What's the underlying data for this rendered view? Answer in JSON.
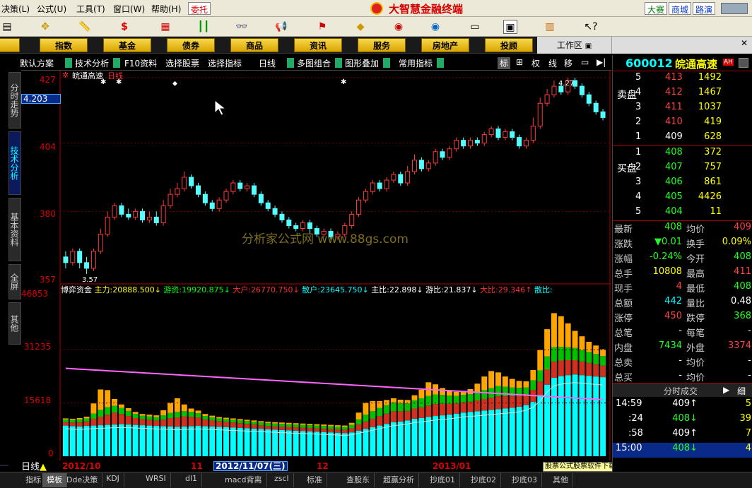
{
  "menu": {
    "items": [
      "决策(L)",
      "公式(U)",
      "工具(T)",
      "窗口(W)",
      "帮助(H)"
    ],
    "trust": "委托",
    "title": "大智慧金融终端",
    "right": [
      "大赛",
      "商城",
      "路演"
    ]
  },
  "categories": [
    "股",
    "指数",
    "基金",
    "债券",
    "商品",
    "资讯",
    "服务",
    "房地产",
    "投顾"
  ],
  "workarea": "工作区",
  "subbar": {
    "items": [
      "默认方案",
      "技术分析",
      "F10资料",
      "选择股票",
      "选择指标",
      "日线",
      "多图组合",
      "图形叠加",
      "常用指标"
    ],
    "right": [
      "标",
      "权",
      "线",
      "移"
    ]
  },
  "lefttabs": [
    "分时走势",
    "技术分析",
    "基本资料",
    "全屏",
    "其他"
  ],
  "price_panel": {
    "ticker_label": "皖通高速",
    "period": "日线",
    "input": "4.203",
    "y_labels": [
      "427",
      "404",
      "380",
      "357"
    ],
    "high_label": "4.27",
    "low_label": "3.57"
  },
  "indicator": {
    "name": "博弈资金",
    "items": [
      {
        "label": "主力:",
        "value": "20888.500↓",
        "color": "#ffff00"
      },
      {
        "label": "游资:",
        "value": "19920.875↓",
        "color": "#00ff00"
      },
      {
        "label": "大户:",
        "value": "26770.750↓",
        "color": "#ff3030"
      },
      {
        "label": "散户:",
        "value": "23645.750↓",
        "color": "#00ffff"
      },
      {
        "label": "主比:",
        "value": "22.898↓",
        "color": "#ffffff"
      },
      {
        "label": "游比:",
        "value": "21.837↓",
        "color": "#ffffff"
      },
      {
        "label": "大比:",
        "value": "29.346↑",
        "color": "#ff3030"
      },
      {
        "label": "散比:",
        "value": "",
        "color": "#00ffff"
      }
    ],
    "y_labels": [
      "46853",
      "31235",
      "15618",
      "0"
    ]
  },
  "watermark": "分析家公式网  www.88gs.com",
  "dates": {
    "d1": "2012/10",
    "d2": "11",
    "d3": "2012/11/07(三)",
    "d4": "12",
    "d5": "2013/01"
  },
  "promo": "股票公式股票软件下载[分析家公式网www.88gs.com]",
  "stock": {
    "code": "600012",
    "name": "皖通高速",
    "badge": "AH",
    "asks": [
      {
        "n": "5",
        "p": "413",
        "v": "1492"
      },
      {
        "n": "4",
        "p": "412",
        "v": "1467"
      },
      {
        "n": "3",
        "p": "411",
        "v": "1037"
      },
      {
        "n": "2",
        "p": "410",
        "v": "419"
      },
      {
        "n": "1",
        "p": "409",
        "v": "628"
      }
    ],
    "bids": [
      {
        "n": "1",
        "p": "408",
        "v": "372"
      },
      {
        "n": "2",
        "p": "407",
        "v": "757"
      },
      {
        "n": "3",
        "p": "406",
        "v": "861"
      },
      {
        "n": "4",
        "p": "405",
        "v": "4426"
      },
      {
        "n": "5",
        "p": "404",
        "v": "11"
      }
    ],
    "sell_label": "卖盘",
    "buy_label": "买盘",
    "quotes": [
      {
        "k": "最新",
        "v": "408",
        "vc": "#22ff22",
        "k2": "均价",
        "v2": "409",
        "v2c": "#ff4444"
      },
      {
        "k": "涨跌",
        "v": "▼0.01",
        "vc": "#22ff22",
        "k2": "换手",
        "v2": "0.09%",
        "v2c": "#ffff00"
      },
      {
        "k": "涨幅",
        "v": "-0.24%",
        "vc": "#22ff22",
        "k2": "今开",
        "v2": "408",
        "v2c": "#22ff22"
      },
      {
        "k": "总手",
        "v": "10808",
        "vc": "#ffff00",
        "k2": "最高",
        "v2": "411",
        "v2c": "#ff4444"
      },
      {
        "k": "现手",
        "v": "4",
        "vc": "#ff4444",
        "k2": "最低",
        "v2": "408",
        "v2c": "#22ff22"
      },
      {
        "k": "总额",
        "v": "442",
        "vc": "#00ffff",
        "k2": "量比",
        "v2": "0.48",
        "v2c": "#fff"
      },
      {
        "k": "涨停",
        "v": "450",
        "vc": "#ff4444",
        "k2": "跌停",
        "v2": "368",
        "v2c": "#22ff22"
      },
      {
        "k": "总笔",
        "v": "-",
        "vc": "#fff",
        "k2": "每笔",
        "v2": "-",
        "v2c": "#fff"
      },
      {
        "k": "内盘",
        "v": "7434",
        "vc": "#22ff22",
        "k2": "外盘",
        "v2": "3374",
        "v2c": "#ff4444"
      },
      {
        "k": "总卖",
        "v": "-",
        "vc": "#fff",
        "k2": "均价",
        "v2": "-",
        "v2c": "#fff"
      },
      {
        "k": "总买",
        "v": "-",
        "vc": "#fff",
        "k2": "均价",
        "v2": "-",
        "v2c": "#fff"
      }
    ],
    "ticks_title": "分时成交",
    "ticks_extra": "细",
    "ticks": [
      {
        "t": "14:59",
        "p": "409↑",
        "v": "5"
      },
      {
        "t": ":24",
        "p": "408↓",
        "v": "39"
      },
      {
        "t": ":58",
        "p": "409↑",
        "v": "7"
      },
      {
        "t": "15:00",
        "p": "408↓",
        "v": "4"
      }
    ]
  },
  "bottomtabs": {
    "first": "日线",
    "items": [
      "指标",
      "模板",
      "Dde决策",
      "KDJ",
      "WRSI",
      "dl1",
      "macd背离",
      "zscl",
      "标准",
      "查股东",
      "超赢分析",
      "抄底01",
      "抄底02",
      "抄底03",
      "其他"
    ]
  },
  "chart_data": {
    "type": "candlestick+stacked-bar",
    "candles_ylim": [
      357,
      427
    ],
    "candles": [
      [
        364,
        362,
        366,
        360
      ],
      [
        362,
        366,
        367,
        361
      ],
      [
        366,
        362,
        367,
        360
      ],
      [
        362,
        360,
        364,
        358
      ],
      [
        360,
        366,
        367,
        359
      ],
      [
        366,
        372,
        374,
        365
      ],
      [
        372,
        378,
        380,
        371
      ],
      [
        378,
        382,
        383,
        377
      ],
      [
        382,
        379,
        383,
        378
      ],
      [
        379,
        378,
        381,
        377
      ],
      [
        378,
        380,
        381,
        377
      ],
      [
        380,
        377,
        381,
        376
      ],
      [
        377,
        378,
        380,
        376
      ],
      [
        378,
        376,
        380,
        375
      ],
      [
        376,
        382,
        384,
        375
      ],
      [
        382,
        386,
        388,
        381
      ],
      [
        386,
        388,
        390,
        385
      ],
      [
        388,
        392,
        394,
        387
      ],
      [
        392,
        389,
        393,
        388
      ],
      [
        389,
        386,
        390,
        385
      ],
      [
        386,
        383,
        387,
        382
      ],
      [
        383,
        381,
        384,
        380
      ],
      [
        381,
        384,
        385,
        380
      ],
      [
        384,
        387,
        388,
        383
      ],
      [
        387,
        390,
        391,
        386
      ],
      [
        390,
        388,
        391,
        387
      ],
      [
        388,
        389,
        390,
        387
      ],
      [
        389,
        386,
        390,
        385
      ],
      [
        386,
        383,
        387,
        382
      ],
      [
        383,
        381,
        384,
        380
      ],
      [
        381,
        379,
        382,
        378
      ],
      [
        379,
        377,
        380,
        376
      ],
      [
        377,
        375,
        378,
        374
      ],
      [
        375,
        374,
        376,
        373
      ],
      [
        374,
        376,
        377,
        373
      ],
      [
        376,
        374,
        377,
        372
      ],
      [
        374,
        372,
        375,
        371
      ],
      [
        372,
        373,
        374,
        371
      ],
      [
        373,
        371,
        374,
        370
      ],
      [
        371,
        372,
        373,
        370
      ],
      [
        372,
        375,
        376,
        371
      ],
      [
        375,
        379,
        380,
        374
      ],
      [
        379,
        384,
        385,
        378
      ],
      [
        384,
        387,
        388,
        383
      ],
      [
        387,
        390,
        391,
        386
      ],
      [
        390,
        388,
        391,
        387
      ],
      [
        388,
        391,
        392,
        387
      ],
      [
        391,
        393,
        394,
        390
      ],
      [
        393,
        390,
        394,
        389
      ],
      [
        390,
        394,
        396,
        389
      ],
      [
        394,
        398,
        400,
        393
      ],
      [
        398,
        395,
        399,
        394
      ],
      [
        395,
        397,
        398,
        394
      ],
      [
        397,
        401,
        402,
        396
      ],
      [
        401,
        399,
        402,
        398
      ],
      [
        399,
        402,
        403,
        398
      ],
      [
        402,
        405,
        406,
        401
      ],
      [
        405,
        403,
        406,
        402
      ],
      [
        403,
        405,
        406,
        402
      ],
      [
        405,
        404,
        406,
        403
      ],
      [
        404,
        407,
        408,
        403
      ],
      [
        407,
        409,
        410,
        406
      ],
      [
        409,
        406,
        410,
        405
      ],
      [
        406,
        408,
        409,
        405
      ],
      [
        408,
        406,
        409,
        405
      ],
      [
        406,
        403,
        407,
        402
      ],
      [
        403,
        405,
        406,
        402
      ],
      [
        405,
        410,
        413,
        404
      ],
      [
        410,
        418,
        420,
        409
      ],
      [
        418,
        421,
        423,
        417
      ],
      [
        421,
        424,
        426,
        420
      ],
      [
        424,
        422,
        425,
        421
      ],
      [
        422,
        426,
        427,
        421
      ],
      [
        426,
        424,
        427,
        423
      ],
      [
        424,
        421,
        425,
        420
      ],
      [
        421,
        418,
        422,
        417
      ],
      [
        418,
        415,
        419,
        414
      ],
      [
        415,
        413,
        416,
        412
      ]
    ],
    "indicator_ylim": [
      0,
      46853
    ],
    "indicator_series": [
      {
        "name": "散户",
        "color": "#00ffff",
        "values": [
          9000,
          8800,
          8700,
          8900,
          9000,
          9100,
          9200,
          9300,
          9400,
          9300,
          9200,
          9100,
          9000,
          8900,
          8800,
          8700,
          8600,
          8700,
          8800,
          8900,
          8800,
          8700,
          8600,
          8500,
          8400,
          8300,
          8200,
          8100,
          8000,
          7900,
          7800,
          7700,
          7600,
          7500,
          7400,
          7300,
          7200,
          7100,
          7000,
          6900,
          6800,
          7000,
          7500,
          8000,
          8500,
          9000,
          9500,
          10000,
          10200,
          10500,
          11000,
          11200,
          11500,
          11800,
          12000,
          12200,
          12500,
          12800,
          13000,
          13200,
          13400,
          13600,
          13800,
          14000,
          14200,
          14500,
          15000,
          16000,
          18000,
          21000,
          23000,
          23500,
          23800,
          24000,
          23800,
          23600,
          23400,
          23200
        ]
      },
      {
        "name": "大户",
        "color": "#d03020",
        "values": [
          1000,
          1100,
          1200,
          1300,
          2000,
          2500,
          3000,
          3500,
          3000,
          2500,
          2000,
          1800,
          1700,
          1600,
          2000,
          2500,
          2800,
          3000,
          2800,
          2500,
          2000,
          1800,
          1700,
          1600,
          1500,
          1400,
          1300,
          1200,
          1100,
          1000,
          1000,
          1000,
          1000,
          1000,
          1000,
          1000,
          1000,
          1000,
          1000,
          1000,
          1000,
          1200,
          1800,
          2200,
          2500,
          2800,
          3000,
          3200,
          3000,
          2800,
          3000,
          3200,
          3400,
          3500,
          3400,
          3200,
          3000,
          3000,
          3000,
          3200,
          3400,
          3600,
          3800,
          3600,
          3400,
          3200,
          3000,
          3500,
          4000,
          4500,
          4800,
          4600,
          4400,
          4200,
          4000,
          3800,
          3600,
          3400
        ]
      },
      {
        "name": "游资",
        "color": "#00c000",
        "values": [
          800,
          800,
          900,
          900,
          1500,
          2000,
          2200,
          2000,
          1800,
          1500,
          1200,
          1000,
          1000,
          1000,
          1200,
          1500,
          1600,
          1500,
          1400,
          1200,
          1000,
          900,
          800,
          800,
          800,
          800,
          800,
          800,
          800,
          800,
          800,
          800,
          800,
          800,
          800,
          800,
          800,
          800,
          800,
          800,
          800,
          1000,
          1500,
          2000,
          2200,
          2400,
          2500,
          2600,
          2400,
          2200,
          2400,
          2600,
          2800,
          2800,
          2600,
          2400,
          2200,
          2200,
          2200,
          2400,
          2600,
          2800,
          3000,
          2800,
          2600,
          2400,
          2200,
          2800,
          3200,
          3800,
          4200,
          4000,
          3800,
          3600,
          3400,
          3200,
          3000,
          2800
        ]
      },
      {
        "name": "主力",
        "color": "#ffa500",
        "values": [
          300,
          300,
          400,
          500,
          3000,
          6000,
          5000,
          2000,
          1000,
          800,
          600,
          500,
          500,
          500,
          1500,
          3000,
          4000,
          2000,
          1000,
          800,
          600,
          500,
          400,
          400,
          400,
          400,
          400,
          400,
          400,
          400,
          400,
          400,
          400,
          400,
          400,
          400,
          400,
          400,
          400,
          400,
          400,
          600,
          2000,
          3500,
          3000,
          2000,
          1500,
          1200,
          1000,
          1000,
          1500,
          2500,
          4000,
          3000,
          2000,
          1500,
          1200,
          1200,
          1500,
          2500,
          4000,
          5000,
          4000,
          3000,
          2500,
          2000,
          1800,
          3000,
          6000,
          8000,
          10000,
          9000,
          7000,
          5000,
          4000,
          3000,
          2500,
          2000
        ]
      }
    ]
  }
}
